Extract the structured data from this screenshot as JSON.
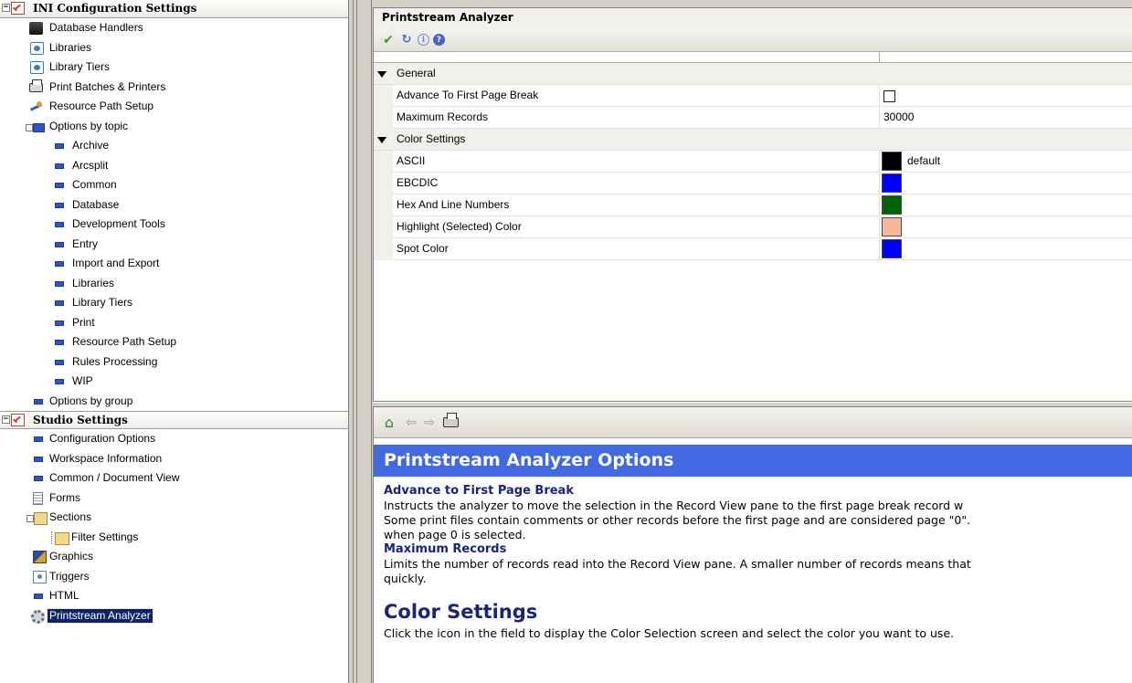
{
  "left_tree": {
    "ini_header": "INI Configuration Settings",
    "ini_items": [
      {
        "label": "Database Handlers",
        "icon": "database-icon"
      },
      {
        "label": "Libraries",
        "icon": "library-icon"
      },
      {
        "label": "Library Tiers",
        "icon": "library-icon"
      },
      {
        "label": "Print Batches & Printers",
        "icon": "printer-icon"
      },
      {
        "label": "Resource Path Setup",
        "icon": "resource-path-icon"
      }
    ],
    "options_by_topic": "Options by topic",
    "topic_items": [
      "Archive",
      "Arcsplit",
      "Common",
      "Database",
      "Development Tools",
      "Entry",
      "Import and Export",
      "Libraries",
      "Library Tiers",
      "Print",
      "Resource Path Setup",
      "Rules Processing",
      "WIP"
    ],
    "options_by_group": "Options by group",
    "studio_header": "Studio Settings",
    "studio_items": [
      {
        "label": "Configuration Options",
        "icon": "bullet-icon"
      },
      {
        "label": "Workspace Information",
        "icon": "bullet-icon"
      },
      {
        "label": "Common / Document View",
        "icon": "bullet-icon"
      },
      {
        "label": "Forms",
        "icon": "form-icon"
      },
      {
        "label": "Sections",
        "icon": "sections-icon"
      },
      {
        "label": "Filter Settings",
        "icon": "filter-icon"
      },
      {
        "label": "Graphics",
        "icon": "graphics-icon"
      },
      {
        "label": "Triggers",
        "icon": "triggers-icon"
      },
      {
        "label": "HTML",
        "icon": "bullet-icon"
      },
      {
        "label": "Printstream Analyzer",
        "icon": "gear-icon",
        "selected": true
      }
    ]
  },
  "panel": {
    "title": "Printstream Analyzer",
    "toolbar": [
      "check-icon",
      "refresh-icon",
      "info-icon",
      "help-icon"
    ],
    "general_label": "General",
    "advance_label": "Advance To First Page Break",
    "advance_checked": false,
    "max_records_label": "Maximum Records",
    "max_records_value": "30000",
    "color_settings_label": "Color Settings",
    "colors": [
      {
        "label": "ASCII",
        "color": "#000000",
        "text": "default"
      },
      {
        "label": "EBCDIC",
        "color": "#0000ff",
        "text": ""
      },
      {
        "label": "Hex And Line Numbers",
        "color": "#006400",
        "text": ""
      },
      {
        "label": "Highlight (Selected) Color",
        "color": "#f4b89a",
        "text": ""
      },
      {
        "label": "Spot Color",
        "color": "#0000ff",
        "text": ""
      }
    ]
  },
  "help": {
    "toolbar": [
      "home-icon",
      "back-icon",
      "forward-icon",
      "print-icon"
    ],
    "banner": "Printstream Analyzer Options",
    "advance_heading": "Advance to First Page Break",
    "advance_line1": "Instructs the analyzer to move the selection in the Record View pane to the first page break record w",
    "advance_line2": "Some print files contain comments or other records before the first page and are considered page \"0\".",
    "advance_line3": "when page 0 is selected.",
    "max_heading": "Maximum Records",
    "max_line1": "Limits the number of records read into the Record View pane. A smaller number of records means that",
    "max_line2": "quickly.",
    "color_heading": "Color Settings",
    "color_line1": "Click the icon in the field to display the Color Selection screen and select the color you want to use."
  }
}
